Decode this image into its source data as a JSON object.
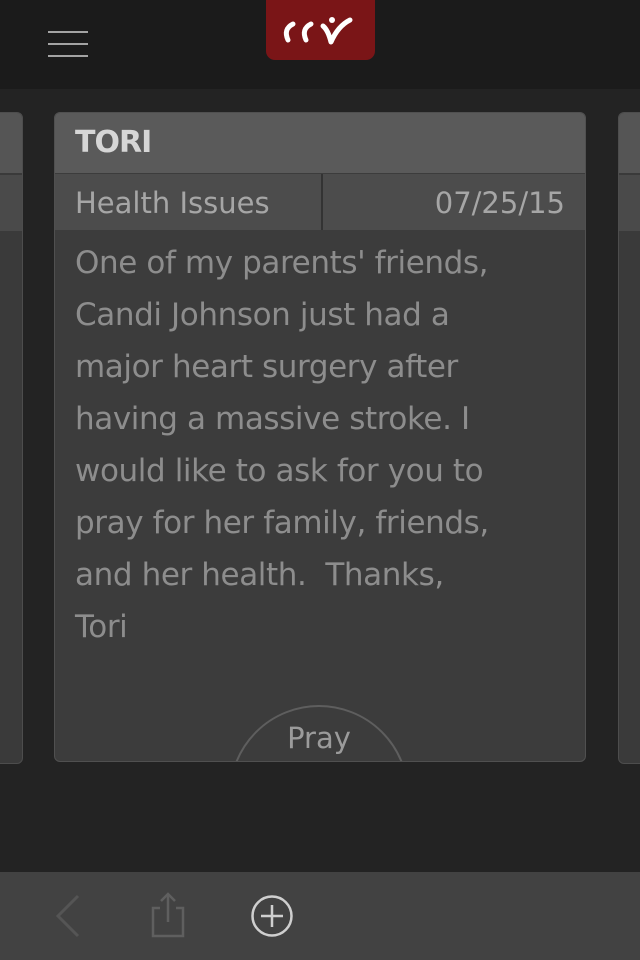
{
  "app": {
    "logo_alt": "CCV"
  },
  "topbar": {
    "menu_icon": "hamburger-menu-icon"
  },
  "prayer_card": {
    "name": "TORI",
    "category": "Health Issues",
    "date": "07/25/15",
    "body": "One of my parents' friends,\nCandi Johnson just had a\nmajor heart surgery after\nhaving a massive stroke. I\nwould like to ask for you to\npray for her family, friends,\nand her health.  Thanks,\nTori",
    "pray_label": "Pray"
  },
  "bottombar": {
    "back_icon": "chevron-left-icon",
    "share_icon": "share-icon",
    "add_icon": "plus-circle-icon"
  },
  "colors": {
    "brand": "#7a1517",
    "background": "#232323",
    "card_header": "#5a5a5a"
  }
}
